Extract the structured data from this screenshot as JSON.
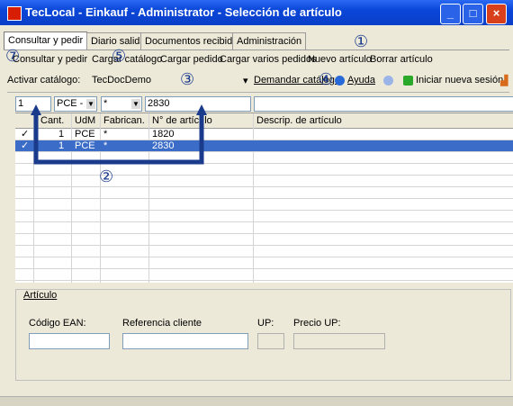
{
  "window": {
    "title": "TecLocal - Einkauf - Administrator - Selección de artículo"
  },
  "tabs": [
    {
      "label": "Consultar y pedir"
    },
    {
      "label": "Diario salida"
    },
    {
      "label": "Documentos recibidos"
    },
    {
      "label": "Administración"
    }
  ],
  "toolbar": {
    "items": [
      {
        "label": "Consultar y pedir"
      },
      {
        "label": "Cargar catálogo"
      },
      {
        "label": "Cargar pedido"
      },
      {
        "label": "Cargar varios pedidos"
      },
      {
        "label": "Nuevo artículo"
      },
      {
        "label": "Borrar artículo"
      }
    ]
  },
  "catalog": {
    "label": "Activar catálogo:",
    "value": "TecDocDemo",
    "demand_label": "Demandar catálogo",
    "help_label": "Ayuda",
    "new_session_label": "Iniciar nueva sesión"
  },
  "inputs": {
    "qty": "1",
    "uom": "PCE - U",
    "manufacturer": "*",
    "article_no": "2830",
    "description": ""
  },
  "grid": {
    "headers": [
      "Cant.",
      "UdM",
      "Fabrican.",
      "N° de artículo",
      "Descrip. de artículo"
    ],
    "rows": [
      {
        "qty": "1",
        "uom": "PCE",
        "mfr": "*",
        "artno": "1820",
        "desc": "",
        "selected": false,
        "mark": "✓"
      },
      {
        "qty": "1",
        "uom": "PCE",
        "mfr": "*",
        "artno": "2830",
        "desc": "",
        "selected": true,
        "mark": "✓"
      }
    ]
  },
  "article": {
    "section_label": "Artículo",
    "ean_label": "Código EAN:",
    "ref_label": "Referencia cliente",
    "up_label": "UP:",
    "price_label": "Precio UP:"
  },
  "callouts": [
    "①",
    "②",
    "③",
    "④",
    "⑤",
    "⑦"
  ],
  "colors": {
    "titlebar": "#0a46d8",
    "selection": "#3a6cc8",
    "callout": "#1a3a8c"
  }
}
